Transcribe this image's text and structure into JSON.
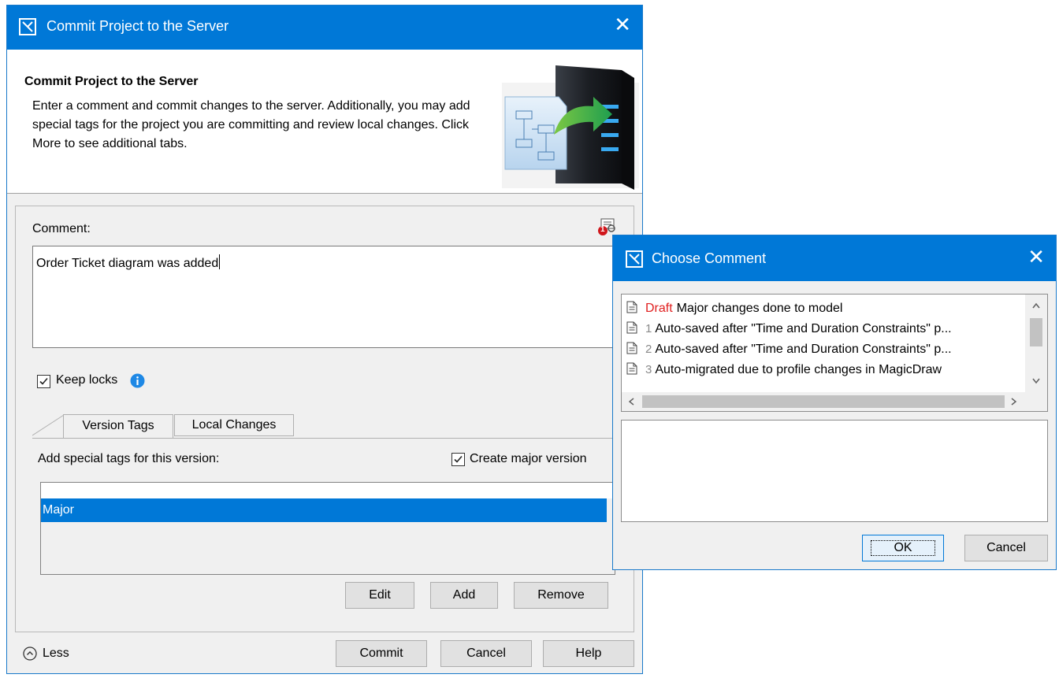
{
  "main_dialog": {
    "window_title": "Commit Project to the Server",
    "header_title": "Commit Project to the Server",
    "header_description": "Enter a comment and commit changes to the server. Additionally, you may add special tags for the project you are committing and review local changes. Click More to see additional tabs.",
    "comment_label": "Comment:",
    "comment_badge": "1",
    "comment_value": "Order Ticket diagram was added",
    "keep_locks_label": "Keep locks",
    "keep_locks_checked": true,
    "tabs": [
      {
        "label": "Version Tags",
        "active": true
      },
      {
        "label": "Local Changes",
        "active": false
      }
    ],
    "tags_label": "Add special tags for this version:",
    "create_major_label": "Create major version",
    "create_major_checked": true,
    "tags": [
      "Major"
    ],
    "edit_label": "Edit",
    "add_label": "Add",
    "remove_label": "Remove",
    "less_label": "Less",
    "commit_label": "Commit",
    "cancel_label": "Cancel",
    "help_label": "Help"
  },
  "choose_dialog": {
    "window_title": "Choose Comment",
    "items": [
      {
        "tag": "Draft",
        "text": "Major changes done to model"
      },
      {
        "num": "1",
        "text": "Auto-saved after \"Time and Duration Constraints\" p..."
      },
      {
        "num": "2",
        "text": "Auto-saved after \"Time and Duration Constraints\" p..."
      },
      {
        "num": "3",
        "text": "Auto-migrated due to profile changes in MagicDraw"
      }
    ],
    "ok_label": "OK",
    "cancel_label": "Cancel"
  },
  "colors": {
    "titlebar": "#0078d7",
    "selection": "#0078d7",
    "draft": "#e02020",
    "info": "#1e88e5"
  },
  "icons": {
    "window": "app-window-icon",
    "close": "close-icon",
    "server_illustration": "server-commit-illustration",
    "comment_history": "comment-history-icon",
    "info": "info-icon",
    "document": "document-icon",
    "collapse": "chevron-up-circle-icon"
  }
}
